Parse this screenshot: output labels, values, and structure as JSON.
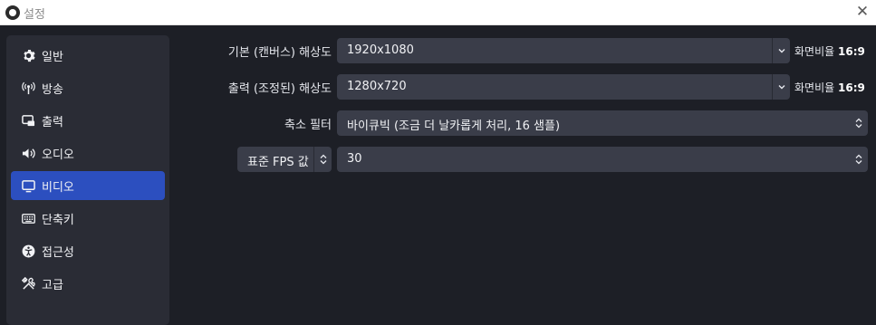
{
  "window": {
    "title": "설정"
  },
  "sidebar": {
    "items": [
      {
        "label": "일반",
        "icon": "gear-icon",
        "active": false
      },
      {
        "label": "방송",
        "icon": "broadcast-icon",
        "active": false
      },
      {
        "label": "출력",
        "icon": "output-icon",
        "active": false
      },
      {
        "label": "오디오",
        "icon": "speaker-icon",
        "active": false
      },
      {
        "label": "비디오",
        "icon": "monitor-icon",
        "active": true
      },
      {
        "label": "단축키",
        "icon": "keyboard-icon",
        "active": false
      },
      {
        "label": "접근성",
        "icon": "accessibility-icon",
        "active": false
      },
      {
        "label": "고급",
        "icon": "tools-icon",
        "active": false
      }
    ]
  },
  "video": {
    "base_resolution": {
      "label": "기본 (캔버스) 해상도",
      "value": "1920x1080",
      "aspect_prefix": "화면비율",
      "aspect_value": "16:9"
    },
    "output_resolution": {
      "label": "출력 (조정된) 해상도",
      "value": "1280x720",
      "aspect_prefix": "화면비율",
      "aspect_value": "16:9"
    },
    "downscale_filter": {
      "label": "축소 필터",
      "value": "바이큐빅 (조금 더 날카롭게 처리, 16 샘플)"
    },
    "fps": {
      "type_value": "표준 FPS 값",
      "value": "30"
    }
  },
  "colors": {
    "background": "#1d1f26",
    "sidebar": "#2a2c35",
    "active_item": "#2c4fbf",
    "control": "#3a3d49"
  }
}
